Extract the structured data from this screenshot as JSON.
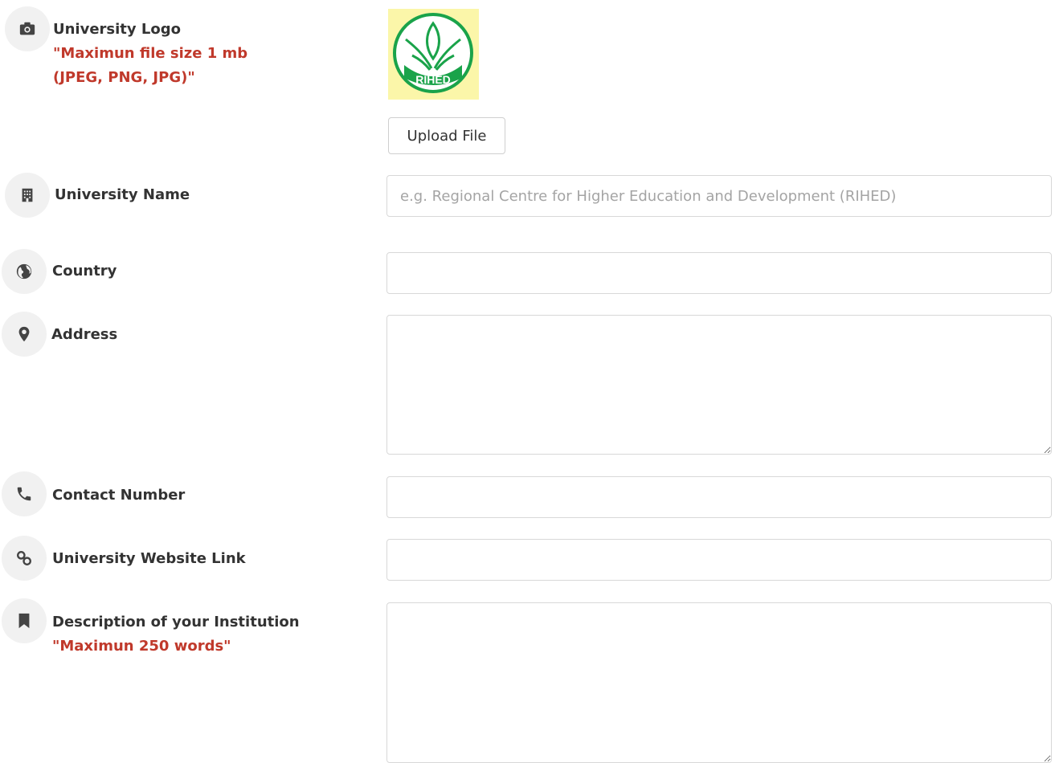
{
  "fields": {
    "logo": {
      "label": "University Logo",
      "note_line1": "\"Maximun file size 1 mb",
      "note_line2": "(JPEG, PNG, JPG)\"",
      "icon": "camera-icon"
    },
    "upload_button": "Upload File",
    "logo_image_text": "RIHED",
    "name": {
      "label": "University Name",
      "placeholder": "e.g. Regional Centre for Higher Education and Development (RIHED)",
      "icon": "building-icon"
    },
    "country": {
      "label": "Country",
      "value": "",
      "icon": "globe-icon"
    },
    "address": {
      "label": "Address",
      "value": "",
      "icon": "map-marker-icon"
    },
    "contact": {
      "label": "Contact Number",
      "value": "",
      "icon": "phone-icon"
    },
    "website": {
      "label": "University Website Link",
      "value": "",
      "icon": "link-icon"
    },
    "description": {
      "label": "Description of your Institution",
      "note": "\"Maximun 250 words\"",
      "icon": "bookmark-icon"
    }
  },
  "colors": {
    "note": "#c0392b",
    "label": "#333333",
    "icon_bg": "#f1f1f1",
    "logo_green": "#1aa34a",
    "logo_bg": "#fbf6a9"
  }
}
